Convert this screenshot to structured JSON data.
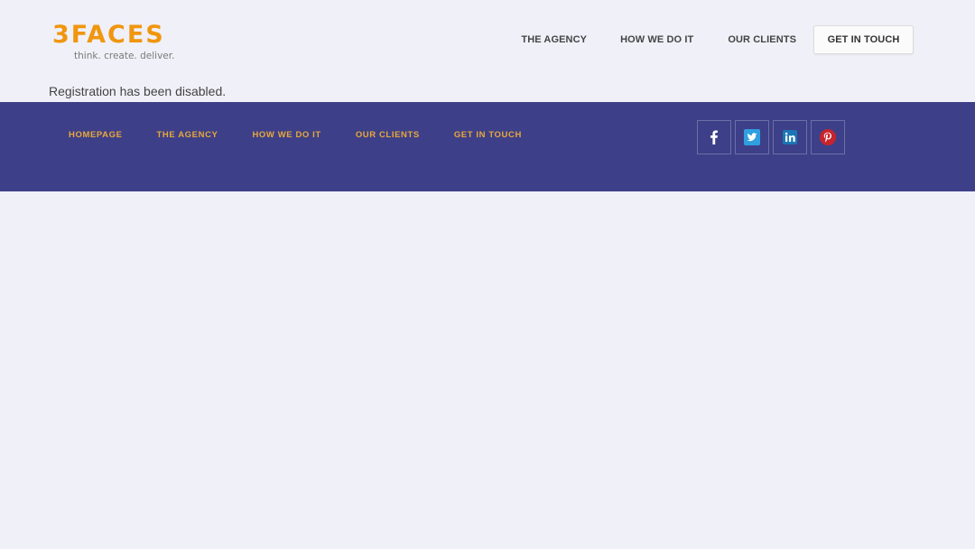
{
  "brand": {
    "name": "3FACES",
    "tagline": "think. create. deliver.",
    "color": "#f0960f"
  },
  "header": {
    "nav": [
      {
        "label": "THE AGENCY"
      },
      {
        "label": "HOW WE DO IT"
      },
      {
        "label": "OUR CLIENTS"
      }
    ],
    "cta_label": "GET IN TOUCH"
  },
  "main": {
    "notice": "Registration has been disabled."
  },
  "footer": {
    "background": "#3d4088",
    "link_color": "#e9a73c",
    "nav": [
      {
        "label": "HOMEPAGE"
      },
      {
        "label": "THE AGENCY"
      },
      {
        "label": "HOW WE DO IT"
      },
      {
        "label": "OUR CLIENTS"
      },
      {
        "label": "GET IN TOUCH"
      }
    ],
    "social": [
      {
        "icon": "facebook-icon"
      },
      {
        "icon": "twitter-icon"
      },
      {
        "icon": "linkedin-icon"
      },
      {
        "icon": "pinterest-icon"
      }
    ]
  }
}
